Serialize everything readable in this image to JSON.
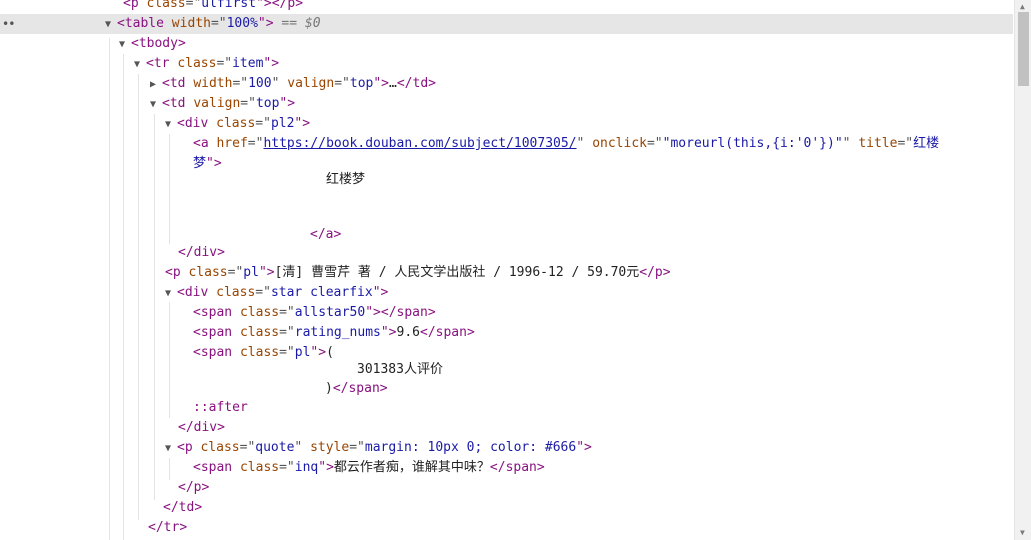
{
  "selection": {
    "marker": "••",
    "suffix": "== $0"
  },
  "lines": [
    {
      "parts": [
        "<",
        "p",
        " ",
        "class",
        "=\"",
        "ulfirst",
        "\">",
        "</",
        "p",
        ">"
      ]
    },
    {
      "parts": [
        "<",
        "table",
        " ",
        "width",
        "=\"",
        "100%",
        "\">"
      ]
    },
    {
      "parts": [
        "<",
        "tbody",
        ">"
      ]
    },
    {
      "parts": [
        "<",
        "tr",
        " ",
        "class",
        "=\"",
        "item",
        "\">"
      ]
    },
    {
      "parts": [
        "<",
        "td",
        " ",
        "width",
        "=\"",
        "100",
        "\"",
        " ",
        "valign",
        "=\"",
        "top",
        "\">",
        "…",
        "</",
        "td",
        ">"
      ]
    },
    {
      "parts": [
        "<",
        "td",
        " ",
        "valign",
        "=\"",
        "top",
        "\">"
      ]
    },
    {
      "parts": [
        "<",
        "div",
        " ",
        "class",
        "=\"",
        "pl2",
        "\">"
      ]
    },
    {
      "parts": [
        "<",
        "a",
        " ",
        "href",
        "=\"",
        "https://book.douban.com/subject/1007305/",
        "\"",
        " ",
        "onclick",
        "=\"",
        "\"moreurl(this,{i:'0'})\"",
        "\"",
        " ",
        "title",
        "=\"",
        "红楼"
      ]
    },
    {
      "parts": [
        "梦",
        "\">"
      ]
    },
    {
      "parts": [
        "红楼梦"
      ]
    },
    {
      "parts": [
        "</",
        "a",
        ">"
      ]
    },
    {
      "parts": [
        "</",
        "div",
        ">"
      ]
    },
    {
      "parts": [
        "<",
        "p",
        " ",
        "class",
        "=\"",
        "pl",
        "\">",
        "[清] 曹雪芹 著 / 人民文学出版社 / 1996-12 / 59.70元",
        "</",
        "p",
        ">"
      ]
    },
    {
      "parts": [
        "<",
        "div",
        " ",
        "class",
        "=\"",
        "star clearfix",
        "\">"
      ]
    },
    {
      "parts": [
        "<",
        "span",
        " ",
        "class",
        "=\"",
        "allstar50",
        "\">",
        "</",
        "span",
        ">"
      ]
    },
    {
      "parts": [
        "<",
        "span",
        " ",
        "class",
        "=\"",
        "rating_nums",
        "\">",
        "9.6",
        "</",
        "span",
        ">"
      ]
    },
    {
      "parts": [
        "<",
        "span",
        " ",
        "class",
        "=\"",
        "pl",
        "\">",
        "("
      ]
    },
    {
      "parts": [
        "301383人评价"
      ]
    },
    {
      "parts": [
        ")",
        "</",
        "span",
        ">"
      ]
    },
    {
      "parts": [
        "::after"
      ]
    },
    {
      "parts": [
        "</",
        "div",
        ">"
      ]
    },
    {
      "parts": [
        "<",
        "p",
        " ",
        "class",
        "=\"",
        "quote",
        "\"",
        " ",
        "style",
        "=\"",
        "margin: 10px 0; color: #666",
        "\">"
      ]
    },
    {
      "parts": [
        "<",
        "span",
        " ",
        "class",
        "=\"",
        "inq",
        "\">",
        "都云作者痴，谁解其中味？",
        "</",
        "span",
        ">"
      ]
    },
    {
      "parts": [
        "</",
        "p",
        ">"
      ]
    },
    {
      "parts": [
        "</",
        "td",
        ">"
      ]
    },
    {
      "parts": [
        "</",
        "tr",
        ">"
      ]
    }
  ],
  "icons": {
    "expanded": "expanded-triangle-icon",
    "collapsed": "collapsed-triangle-icon"
  },
  "colors": {
    "tag": "#881280",
    "attr_name": "#994500",
    "attr_value": "#1a1aa6",
    "selection_bg": "#e6e6e6"
  }
}
